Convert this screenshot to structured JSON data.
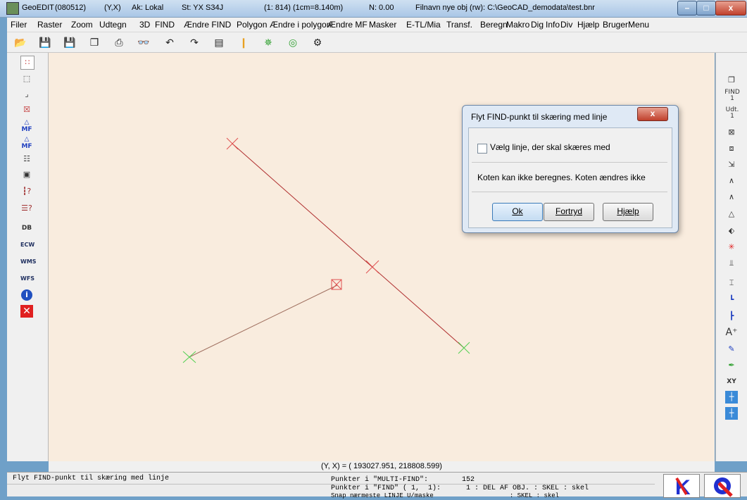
{
  "window": {
    "app": "GeoEDIT",
    "version": "(080512)",
    "yx": "(Y,X)",
    "ak": "Ak: Lokal",
    "st": "St: YX S34J",
    "scale": "(1:  814) (1cm=8.140m)",
    "n": "N:  0.00",
    "file": "Filnavn nye obj  (rw): C:\\GeoCAD_demodata\\test.bnr",
    "btn_min": "–",
    "btn_max": "□",
    "btn_close": "x"
  },
  "menu": [
    "Filer",
    "Raster",
    "Zoom",
    "Udtegn",
    "3D",
    "FIND",
    "Ændre FIND",
    "Polygon",
    "Ændre i polygon",
    "Ændre MF",
    "Masker",
    "E-TL/Mia",
    "Transf.",
    "Beregn",
    "Makro",
    "Dig",
    "Info",
    "Div",
    "Hjælp",
    "BrugerMenu"
  ],
  "left_toolbar": {
    "mf1": "MF",
    "mf2": "MF",
    "db": "DB",
    "ecw": "ECW",
    "wms": "WMS",
    "wfs": "WFS",
    "info": "i"
  },
  "right_toolbar": {
    "find": "FIND",
    "find_sub": "1",
    "udt": "Udt.",
    "udt_sub": "1",
    "xy": "XY"
  },
  "coordinate_readout": "(Y, X) = ( 193027.951,  218808.599)",
  "status": {
    "left": "Flyt FIND-punkt til skæring med linje",
    "line1": "Punkter i \"MULTI-FIND\":        152",
    "line2": "Punkter i \"FIND\" ( 1,  1):      1 : DEL AF OBJ. : SKEL : skel",
    "line3": "Snap nærmeste LINJE U/maske                    : SKEL : skel"
  },
  "dialog": {
    "title": "Flyt FIND-punkt til skæring med linje",
    "close": "x",
    "checkbox_label": "Vælg linje, der skal skæres med",
    "checkbox_checked": false,
    "message": "Koten kan ikke beregnes. Koten ændres ikke",
    "ok": "Ok",
    "cancel": "Fortryd",
    "help": "Hjælp"
  },
  "colors": {
    "canvas": "#f9ecde",
    "line_red": "#b03030",
    "line_green": "#30a030",
    "marker_red": "#e05050",
    "marker_green": "#50d050"
  }
}
